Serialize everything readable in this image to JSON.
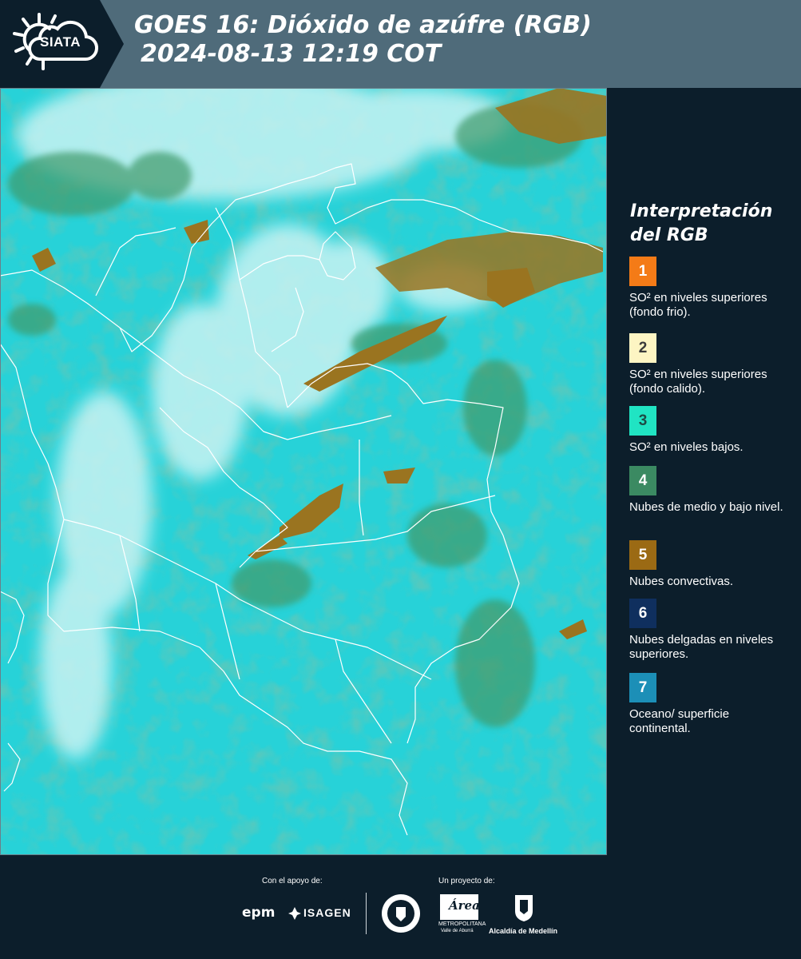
{
  "header": {
    "logo_text": "SIATA",
    "title_line1": "GOES 16: Dióxido de azúfre (RGB)",
    "title_line2": "2024-08-13 12:19 COT"
  },
  "legend": {
    "title_line1": "Interpretación",
    "title_line2": "del RGB",
    "items": [
      {
        "num": "1",
        "label": "SO² en niveles superiores (fondo frio).",
        "color": "#f47b17",
        "text_color": "#ffffff"
      },
      {
        "num": "2",
        "label": "SO² en niveles superiores (fondo calido).",
        "color": "#fdf5c3",
        "text_color": "#3a3a3a"
      },
      {
        "num": "3",
        "label": "SO² en niveles bajos.",
        "color": "#20e4c3",
        "text_color": "#1d4b45"
      },
      {
        "num": "4",
        "label": "Nubes de medio y bajo nivel.",
        "color": "#3b8a62",
        "text_color": "#ffffff"
      },
      {
        "num": "5",
        "label": "Nubes convectivas.",
        "color": "#9b6a14",
        "text_color": "#ffffff"
      },
      {
        "num": "6",
        "label": "Nubes delgadas en niveles superiores.",
        "color": "#0f2f5e",
        "text_color": "#ffffff"
      },
      {
        "num": "7",
        "label": "Oceano/ superficie continental.",
        "color": "#1c8fb7",
        "text_color": "#ffffff"
      }
    ]
  },
  "footer": {
    "support_label": "Con el apoyo de:",
    "project_label": "Un proyecto de:",
    "sponsor1": "epm",
    "sponsor2": "ISAGEN",
    "partner1": "METROPOLITANA",
    "partner1_sub": "Valle de Aburrá",
    "partner1_name": "Área",
    "partner2": "Alcaldía de Medellín"
  },
  "map": {
    "ocean_color": "#27d2d8",
    "cloud_color": "#c9f3f3",
    "low_cloud_color": "#3f9a6b",
    "convective_color": "#9a7420",
    "border_color": "#ffffff"
  }
}
